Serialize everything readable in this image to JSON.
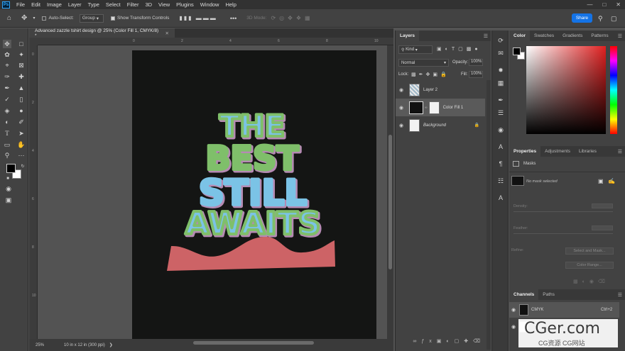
{
  "menubar": {
    "logo": "Ps",
    "items": [
      "File",
      "Edit",
      "Image",
      "Layer",
      "Type",
      "Select",
      "Filter",
      "3D",
      "View",
      "Plugins",
      "Window",
      "Help"
    ]
  },
  "options": {
    "auto_select_label": "Auto-Select:",
    "auto_select_value": "Group",
    "show_transform_label": "Show Transform Controls",
    "mode_label": "3D Mode:",
    "share_label": "Share"
  },
  "document": {
    "tab_title": "Advanced zazzle tshirt design @ 25% (Color Fill 1, CMYK/8) *",
    "zoom": "25%",
    "doc_info": "10 in x 12 in (300 ppi)",
    "ruler_h": [
      "0",
      "2",
      "4",
      "6",
      "8",
      "10"
    ],
    "ruler_v": [
      "0",
      "2",
      "4",
      "6",
      "8",
      "10"
    ]
  },
  "artwork": {
    "lines": [
      "THE",
      "BEST",
      "STILL",
      "AWAITS"
    ],
    "colors": {
      "background": "#141514",
      "green": "#7fbf6a",
      "blue": "#7bc3e6",
      "shadow": "#b58ab3",
      "wave": "#cd6366"
    }
  },
  "layers": {
    "tabs": [
      "Layers"
    ],
    "filter_kind": "Kind",
    "blend_mode": "Normal",
    "opacity_label": "Opacity:",
    "opacity_value": "100%",
    "lock_label": "Lock:",
    "fill_label": "Fill:",
    "fill_value": "100%",
    "items": [
      {
        "name": "Layer 2"
      },
      {
        "name": "Color Fill 1"
      },
      {
        "name": "Background"
      }
    ]
  },
  "color_panel": {
    "tabs": [
      "Color",
      "Swatches",
      "Gradients",
      "Patterns"
    ]
  },
  "properties_panel": {
    "tabs": [
      "Properties",
      "Adjustments",
      "Libraries"
    ],
    "section_title": "Masks",
    "mask_status": "No mask selected",
    "density_label": "Density:",
    "feather_label": "Feather:",
    "refine_label": "Refine:",
    "select_mask_label": "Select and Mask...",
    "color_range_label": "Color Range..."
  },
  "channels_panel": {
    "tabs": [
      "Channels",
      "Paths"
    ],
    "items": [
      {
        "name": "CMYK",
        "shortcut": "Ctrl+2"
      }
    ]
  },
  "watermark": {
    "title": "CGer.com",
    "subtitle": "CG资源 CG网站"
  }
}
